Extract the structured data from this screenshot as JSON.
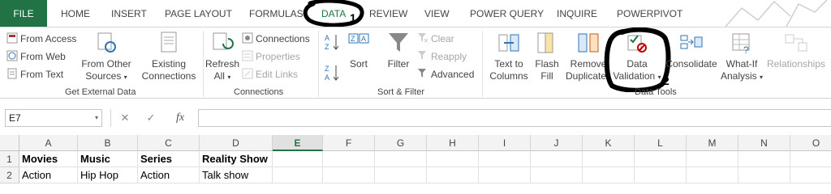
{
  "tabs": {
    "file": "FILE",
    "home": "HOME",
    "insert": "INSERT",
    "page_layout": "PAGE LAYOUT",
    "formulas": "FORMULAS",
    "data": "DATA",
    "review": "REVIEW",
    "view": "VIEW",
    "power_query": "POWER QUERY",
    "inquire": "INQUIRE",
    "powerpivot": "POWERPIVOT"
  },
  "annotations": {
    "marker1": "1",
    "marker2": "2"
  },
  "ribbon": {
    "get_external_data": {
      "from_access": "From Access",
      "from_web": "From Web",
      "from_text": "From Text",
      "from_other_sources_1": "From Other",
      "from_other_sources_2": "Sources",
      "existing_connections_1": "Existing",
      "existing_connections_2": "Connections",
      "group_label": "Get External Data"
    },
    "connections": {
      "refresh_all_1": "Refresh",
      "refresh_all_2": "All",
      "connections": "Connections",
      "properties": "Properties",
      "edit_links": "Edit Links",
      "group_label": "Connections"
    },
    "sort_filter": {
      "sort": "Sort",
      "filter": "Filter",
      "clear": "Clear",
      "reapply": "Reapply",
      "advanced": "Advanced",
      "group_label": "Sort & Filter"
    },
    "data_tools": {
      "text_to_columns_1": "Text to",
      "text_to_columns_2": "Columns",
      "flash_fill_1": "Flash",
      "flash_fill_2": "Fill",
      "remove_duplicates_1": "Remove",
      "remove_duplicates_2": "Duplicates",
      "data_validation_1": "Data",
      "data_validation_2": "Validation",
      "consolidate": "Consolidate",
      "what_if_1": "What-If",
      "what_if_2": "Analysis",
      "relationships": "Relationships",
      "group_label": "Data Tools"
    }
  },
  "formula_bar": {
    "name_box": "E7",
    "fx": "fx",
    "cancel": "✕",
    "enter": "✓",
    "value": ""
  },
  "grid": {
    "columns": [
      "A",
      "B",
      "C",
      "D",
      "E",
      "F",
      "G",
      "H",
      "I",
      "J",
      "K",
      "L",
      "M",
      "N",
      "O"
    ],
    "selected_column": "E",
    "rows": [
      {
        "num": "1",
        "A": "Movies",
        "B": "Music",
        "C": "Series",
        "D": "Reality Show"
      },
      {
        "num": "2",
        "A": "Action",
        "B": "Hip Hop",
        "C": "Action",
        "D": "Talk show"
      }
    ]
  },
  "colors": {
    "excel_green": "#217346",
    "tab_text": "#444444",
    "disabled": "#a6a6a6"
  }
}
